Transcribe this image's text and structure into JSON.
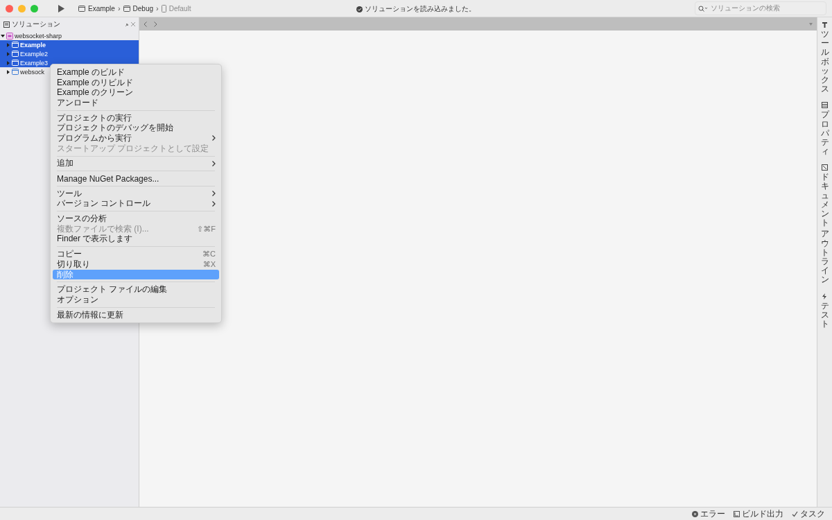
{
  "toolbar": {
    "breadcrumbs": [
      {
        "label": "Example",
        "kind": "project",
        "dim": false,
        "separator": "›"
      },
      {
        "label": "Debug",
        "kind": "project",
        "dim": false,
        "separator": "›"
      },
      {
        "label": "Default",
        "kind": "device",
        "dim": true
      }
    ],
    "status": "ソリューションを読み込みました。",
    "search": {
      "placeholder": "ソリューションの検索"
    }
  },
  "solution_pad": {
    "title": "ソリューション",
    "tree": [
      {
        "label": "websocket-sharp",
        "kind": "solution",
        "expanded": true,
        "selected": false,
        "startup": false,
        "children": [
          {
            "label": "Example",
            "kind": "project",
            "expanded": false,
            "selected": true,
            "startup": true
          },
          {
            "label": "Example2",
            "kind": "project",
            "expanded": false,
            "selected": true,
            "startup": false
          },
          {
            "label": "Example3",
            "kind": "project",
            "expanded": false,
            "selected": true,
            "startup": false
          },
          {
            "label": "websock",
            "kind": "project",
            "expanded": false,
            "selected": false,
            "startup": false
          }
        ]
      }
    ]
  },
  "context_menu": [
    {
      "kind": "item",
      "label": "Example のビルド",
      "disabled": false,
      "selected": false,
      "submenu": false
    },
    {
      "kind": "item",
      "label": "Example のリビルド",
      "disabled": false,
      "selected": false,
      "submenu": false
    },
    {
      "kind": "item",
      "label": "Example のクリーン",
      "disabled": false,
      "selected": false,
      "submenu": false
    },
    {
      "kind": "item",
      "label": "アンロード",
      "disabled": false,
      "selected": false,
      "submenu": false
    },
    {
      "kind": "separator"
    },
    {
      "kind": "item",
      "label": "プロジェクトの実行",
      "disabled": false,
      "selected": false,
      "submenu": false
    },
    {
      "kind": "item",
      "label": "プロジェクトのデバッグを開始",
      "disabled": false,
      "selected": false,
      "submenu": false
    },
    {
      "kind": "item",
      "label": "プログラムから実行",
      "disabled": false,
      "selected": false,
      "submenu": true
    },
    {
      "kind": "item",
      "label": "スタートアップ プロジェクトとして設定",
      "disabled": true,
      "selected": false,
      "submenu": false
    },
    {
      "kind": "separator"
    },
    {
      "kind": "item",
      "label": "追加",
      "disabled": false,
      "selected": false,
      "submenu": true
    },
    {
      "kind": "separator"
    },
    {
      "kind": "item",
      "label": "Manage NuGet Packages...",
      "disabled": false,
      "selected": false,
      "submenu": false
    },
    {
      "kind": "separator"
    },
    {
      "kind": "item",
      "label": "ツール",
      "disabled": false,
      "selected": false,
      "submenu": true
    },
    {
      "kind": "item",
      "label": "バージョン コントロール",
      "disabled": false,
      "selected": false,
      "submenu": true
    },
    {
      "kind": "separator"
    },
    {
      "kind": "item",
      "label": "ソースの分析",
      "disabled": false,
      "selected": false,
      "submenu": false
    },
    {
      "kind": "item",
      "label": "複数ファイルで検索 (I)...",
      "disabled": true,
      "selected": false,
      "submenu": false,
      "shortcut": "⇧⌘F"
    },
    {
      "kind": "item",
      "label": "Finder で表示します",
      "disabled": false,
      "selected": false,
      "submenu": false
    },
    {
      "kind": "separator"
    },
    {
      "kind": "item",
      "label": "コピー",
      "disabled": false,
      "selected": false,
      "submenu": false,
      "shortcut": "⌘C"
    },
    {
      "kind": "item",
      "label": "切り取り",
      "disabled": false,
      "selected": false,
      "submenu": false,
      "shortcut": "⌘X"
    },
    {
      "kind": "item",
      "label": "削除",
      "disabled": false,
      "selected": true,
      "submenu": false
    },
    {
      "kind": "separator"
    },
    {
      "kind": "item",
      "label": "プロジェクト ファイルの編集",
      "disabled": false,
      "selected": false,
      "submenu": false
    },
    {
      "kind": "item",
      "label": "オプション",
      "disabled": false,
      "selected": false,
      "submenu": false
    },
    {
      "kind": "separator"
    },
    {
      "kind": "item",
      "label": "最新の情報に更新",
      "disabled": false,
      "selected": false,
      "submenu": false
    }
  ],
  "right_pads": [
    {
      "words": [
        "ツールボックス"
      ],
      "kind": "toolbox"
    },
    {
      "words": [
        "プロパティ"
      ],
      "kind": "properties"
    },
    {
      "words": [
        "ドキュメント",
        "アウトライン"
      ],
      "kind": "outline"
    },
    {
      "words": [
        "テスト"
      ],
      "kind": "test"
    }
  ],
  "status_bar": [
    {
      "label": "エラー",
      "kind": "error"
    },
    {
      "label": "ビルド出力",
      "kind": "output"
    },
    {
      "label": "タスク",
      "kind": "tasks"
    }
  ]
}
